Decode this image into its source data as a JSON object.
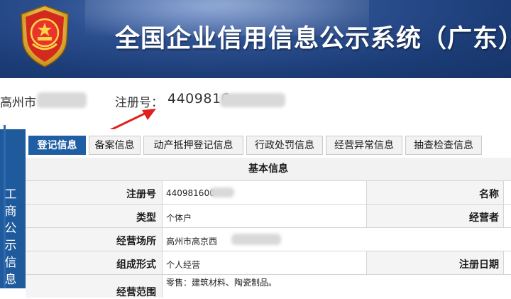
{
  "header": {
    "title": "全国企业信用信息公示系统（广东）"
  },
  "company": {
    "prefix": "高州市",
    "reg_label": "注册号：",
    "reg_visible": "4409816"
  },
  "sidebar": {
    "chars": [
      "工",
      "商",
      "公",
      "示",
      "信",
      "息"
    ]
  },
  "tabs": [
    {
      "label": "登记信息",
      "active": true
    },
    {
      "label": "备案信息",
      "active": false
    },
    {
      "label": "动产抵押登记信息",
      "active": false
    },
    {
      "label": "行政处罚信息",
      "active": false
    },
    {
      "label": "经营异常信息",
      "active": false
    },
    {
      "label": "抽查检查信息",
      "active": false
    }
  ],
  "table": {
    "title": "基本信息",
    "rows": [
      {
        "label": "注册号",
        "value": "440981600",
        "label2": "名称"
      },
      {
        "label": "类型",
        "value": "个体户",
        "label2": "经营者"
      },
      {
        "label": "经营场所",
        "value": "高州市高京西"
      },
      {
        "label": "组成形式",
        "value": "个人经营",
        "label2": "注册日期"
      },
      {
        "label": "经营范围",
        "value": "零售：建筑材料、陶瓷制品。"
      }
    ]
  },
  "colors": {
    "banner": "#1b3c76",
    "active_tab": "#1f5ea3",
    "arrow": "#e02020"
  }
}
